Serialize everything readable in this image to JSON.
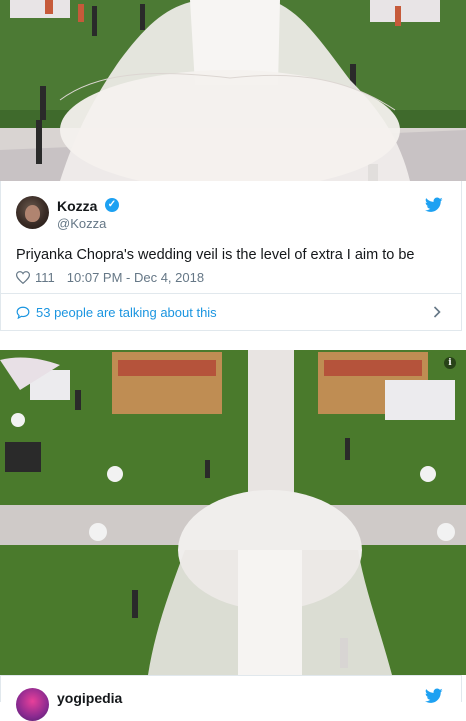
{
  "tweet": {
    "display_name": "Kozza",
    "handle": "@Kozza",
    "text": "Priyanka Chopra's wedding veil is the level of extra I aim to be",
    "likes": "111",
    "timestamp": "10:07 PM - Dec 4, 2018",
    "conversation_label": "53 people are talking about this",
    "verified_icon": "verified-badge-icon",
    "colors": {
      "link": "#1b95e0",
      "muted": "#657786",
      "twitter_blue": "#1da1f2"
    }
  },
  "next_tweet": {
    "display_name": "yogipedia"
  }
}
